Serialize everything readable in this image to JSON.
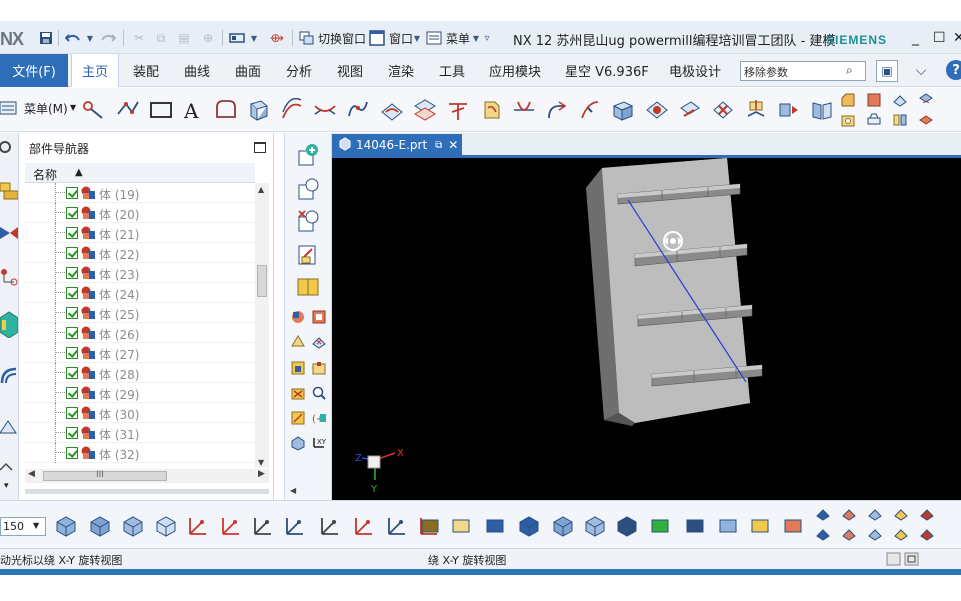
{
  "app": {
    "logo": "NX",
    "title": "NX 12 苏州昆山ug powermill编程培训冒工团队 - 建模",
    "brand": "SIEMENS",
    "accent": "#2e6eb8"
  },
  "quick_access": {
    "switch_window": "切换窗口",
    "window": "窗口",
    "menu": "菜单"
  },
  "window_controls": {
    "minimize": "_",
    "maximize": "☐",
    "close": "✕"
  },
  "menubar": {
    "file": "文件(F)",
    "tabs": [
      "主页",
      "装配",
      "曲线",
      "曲面",
      "分析",
      "视图",
      "渲染",
      "工具",
      "应用模块",
      "星空 V6.936F",
      "电极设计"
    ],
    "active_tab": "主页",
    "search_placeholder": "移除参数",
    "help": "?"
  },
  "ribbon": {
    "menu_button": "菜单(M)"
  },
  "navigator": {
    "title": "部件导航器",
    "column": "名称",
    "rows": [
      "体 (19)",
      "体 (20)",
      "体 (21)",
      "体 (22)",
      "体 (23)",
      "体 (24)",
      "体 (25)",
      "体 (26)",
      "体 (27)",
      "体 (28)",
      "体 (29)",
      "体 (30)",
      "体 (31)",
      "体 (32)"
    ],
    "hscroll_label": "III"
  },
  "document": {
    "tab_label": "14046-E.prt"
  },
  "triad": {
    "x": "X",
    "y": "Y",
    "z": "Z"
  },
  "bottom_toolbar": {
    "zoom_value": "150"
  },
  "status": {
    "left": "动光标以绕 X-Y 旋转视图",
    "center": "绕 X-Y 旋转视图"
  },
  "icons": {
    "save": "save-icon",
    "undo": "undo-icon",
    "redo": "redo-icon",
    "rotate_cursor": "rotate-cursor-icon"
  }
}
